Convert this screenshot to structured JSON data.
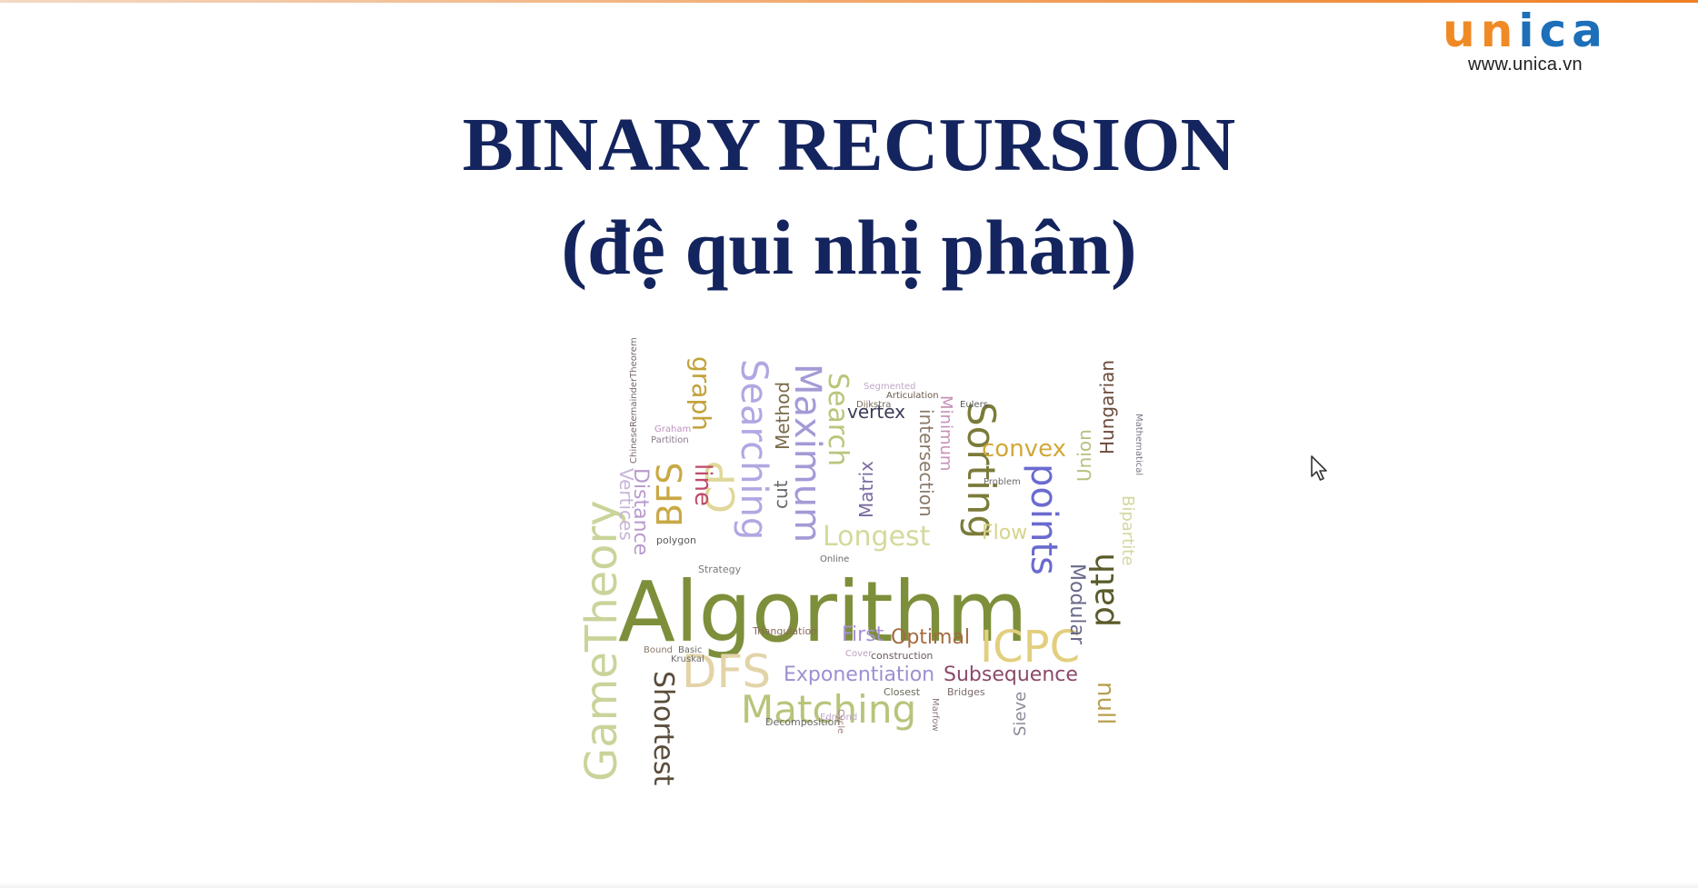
{
  "logo": {
    "u": "u",
    "n": "n",
    "i": "i",
    "c": "c",
    "a": "a",
    "url": "www.unica.vn"
  },
  "slide": {
    "title_line1": "BINARY RECURSION",
    "title_line2": "(đệ qui nhị phân)"
  },
  "word_cloud": {
    "words": [
      {
        "text": "Algorithm",
        "color": "#7d8f3a"
      },
      {
        "text": "GameTheory",
        "color": "#c9d49a"
      },
      {
        "text": "Shortest",
        "color": "#5a4d3a"
      },
      {
        "text": "DFS",
        "color": "#e3d4a8"
      },
      {
        "text": "Matching",
        "color": "#b8c47a"
      },
      {
        "text": "Exponentiation",
        "color": "#9e8fd0"
      },
      {
        "text": "Subsequence",
        "color": "#8a4a6a"
      },
      {
        "text": "ICPC",
        "color": "#e2cf7e"
      },
      {
        "text": "Optimal",
        "color": "#a56a3e"
      },
      {
        "text": "First",
        "color": "#a68fd3"
      },
      {
        "text": "Longest",
        "color": "#d5d99c"
      },
      {
        "text": "Sorting",
        "color": "#7b7b3a"
      },
      {
        "text": "points",
        "color": "#6a6ad0"
      },
      {
        "text": "path",
        "color": "#5a5a2a"
      },
      {
        "text": "null",
        "color": "#b8a050"
      },
      {
        "text": "convex",
        "color": "#d1a83a"
      },
      {
        "text": "Hungarian",
        "color": "#6a4a3a"
      },
      {
        "text": "Maximum",
        "color": "#a39ad6"
      },
      {
        "text": "Searching",
        "color": "#b0a8e2"
      },
      {
        "text": "Search",
        "color": "#b8c67a"
      },
      {
        "text": "graph",
        "color": "#c2a23a"
      },
      {
        "text": "BFS",
        "color": "#c9a845"
      },
      {
        "text": "CP",
        "color": "#e0d79a"
      },
      {
        "text": "line",
        "color": "#c04a6a"
      },
      {
        "text": "Distance",
        "color": "#b89acd"
      },
      {
        "text": "Vertices",
        "color": "#c8b4d8"
      },
      {
        "text": "vertex",
        "color": "#3a3a5a"
      },
      {
        "text": "intersection",
        "color": "#8a7a6a"
      },
      {
        "text": "Minimum",
        "color": "#c690b8"
      },
      {
        "text": "Matrix",
        "color": "#7a6aa0"
      },
      {
        "text": "cut",
        "color": "#6a6a6a"
      },
      {
        "text": "Method",
        "color": "#7a6a4a"
      },
      {
        "text": "Flow",
        "color": "#d8d38a"
      },
      {
        "text": "Modular",
        "color": "#6a6a8a"
      },
      {
        "text": "Union",
        "color": "#b8c080"
      },
      {
        "text": "Bipartite",
        "color": "#d5d6a0"
      },
      {
        "text": "Sieve",
        "color": "#8a8a9a"
      },
      {
        "text": "polygon",
        "color": "#5a5a5a"
      },
      {
        "text": "Strategy",
        "color": "#7a7a7a"
      },
      {
        "text": "Decomposition",
        "color": "#6a6a6a"
      },
      {
        "text": "Triangulation",
        "color": "#8a6a5a"
      },
      {
        "text": "construction",
        "color": "#6a5a5a"
      },
      {
        "text": "Closest",
        "color": "#6a6a5a"
      },
      {
        "text": "Bridges",
        "color": "#7a6a6a"
      },
      {
        "text": "Articulation",
        "color": "#6a5a4a"
      },
      {
        "text": "Dijkstra",
        "color": "#7a6a5a"
      },
      {
        "text": "Segmented",
        "color": "#c0a8c8"
      },
      {
        "text": "Eulers",
        "color": "#5a5a5a"
      },
      {
        "text": "Graham",
        "color": "#c090c0"
      },
      {
        "text": "Partition",
        "color": "#8a7a8a"
      },
      {
        "text": "Problem",
        "color": "#6a6a6a"
      },
      {
        "text": "Kruskal",
        "color": "#6a6a6a"
      },
      {
        "text": "Bound",
        "color": "#8a7a6a"
      },
      {
        "text": "Basic",
        "color": "#6a6a6a"
      },
      {
        "text": "Online",
        "color": "#6a6a6a"
      },
      {
        "text": "Cover",
        "color": "#c0a0c0"
      },
      {
        "text": "Edmond",
        "color": "#c0a8c8"
      },
      {
        "text": "Cycle",
        "color": "#a08080"
      },
      {
        "text": "Marfow",
        "color": "#8a7a7a"
      },
      {
        "text": "Mathematical",
        "color": "#7a7a8a"
      },
      {
        "text": "ChineseRemainderTheorem",
        "color": "#7a6a6a"
      }
    ]
  }
}
